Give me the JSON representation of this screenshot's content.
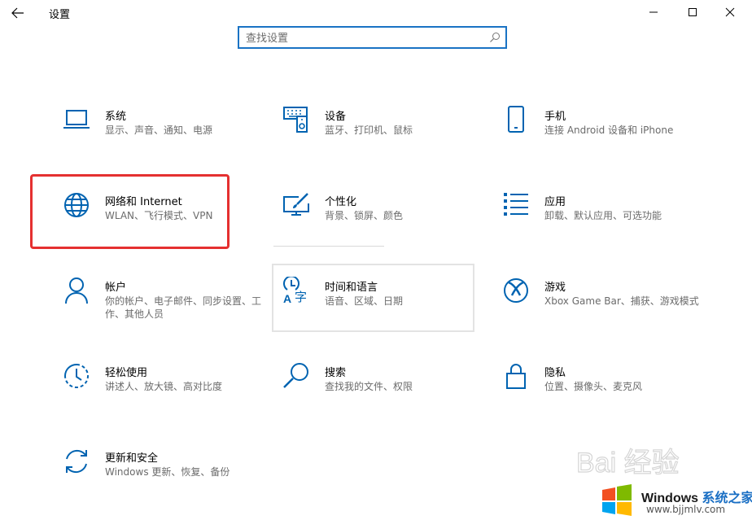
{
  "window": {
    "title": "设置"
  },
  "search": {
    "placeholder": "查找设置"
  },
  "tiles": [
    {
      "id": "system",
      "name": "系统",
      "desc": "显示、声音、通知、电源",
      "icon": "laptop-icon"
    },
    {
      "id": "devices",
      "name": "设备",
      "desc": "蓝牙、打印机、鼠标",
      "icon": "keyboard-speaker-icon"
    },
    {
      "id": "phone",
      "name": "手机",
      "desc": "连接 Android 设备和 iPhone",
      "icon": "phone-icon"
    },
    {
      "id": "network",
      "name": "网络和 Internet",
      "desc": "WLAN、飞行模式、VPN",
      "icon": "globe-icon"
    },
    {
      "id": "personalization",
      "name": "个性化",
      "desc": "背景、锁屏、颜色",
      "icon": "paint-brush-icon"
    },
    {
      "id": "apps",
      "name": "应用",
      "desc": "卸载、默认应用、可选功能",
      "icon": "apps-list-icon"
    },
    {
      "id": "accounts",
      "name": "帐户",
      "desc": "你的帐户、电子邮件、同步设置、工作、其他人员",
      "icon": "person-icon"
    },
    {
      "id": "time-language",
      "name": "时间和语言",
      "desc": "语音、区域、日期",
      "icon": "time-language-icon"
    },
    {
      "id": "gaming",
      "name": "游戏",
      "desc": "Xbox Game Bar、捕获、游戏模式",
      "icon": "xbox-icon"
    },
    {
      "id": "ease-of-access",
      "name": "轻松使用",
      "desc": "讲述人、放大镜、高对比度",
      "icon": "ease-of-access-icon"
    },
    {
      "id": "search",
      "name": "搜索",
      "desc": "查找我的文件、权限",
      "icon": "magnifier-icon"
    },
    {
      "id": "privacy",
      "name": "隐私",
      "desc": "位置、摄像头、麦克风",
      "icon": "lock-icon"
    },
    {
      "id": "update-security",
      "name": "更新和安全",
      "desc": "Windows 更新、恢复、备份",
      "icon": "refresh-icon"
    }
  ],
  "watermark": {
    "baidu": "Bai 经验",
    "site_name_en": "Windows",
    "site_name_cn": "系统之家",
    "site_url": "www.bjjmlv.com"
  },
  "colors": {
    "accent": "#0063b1",
    "search_border": "#1a73c4",
    "highlight": "#e53030",
    "desc_text": "#6b6b6b"
  }
}
